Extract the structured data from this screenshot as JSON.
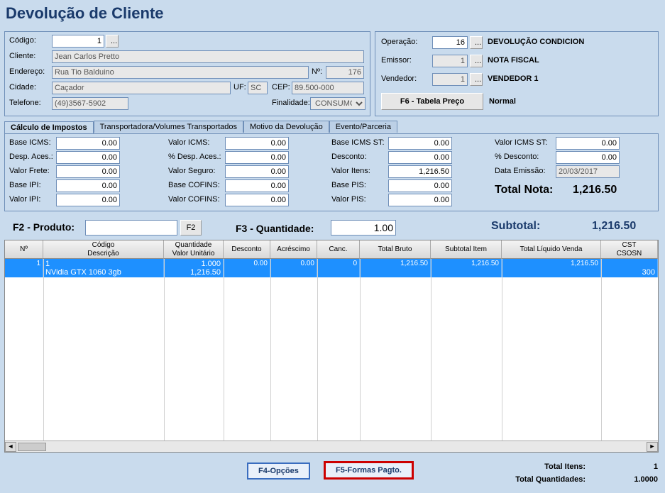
{
  "title": "Devolução de Cliente",
  "left_box": {
    "codigo_label": "Código:",
    "codigo_value": "1",
    "codigo_ellipsis": "...",
    "cliente_label": "Cliente:",
    "cliente_value": "Jean Carlos Pretto",
    "endereco_label": "Endereço:",
    "endereco_value": "Rua Tio Balduino",
    "num_label": "Nº:",
    "num_value": "176",
    "cidade_label": "Cidade:",
    "cidade_value": "Caçador",
    "uf_label": "UF:",
    "uf_value": "SC",
    "cep_label": "CEP:",
    "cep_value": "89.500-000",
    "telefone_label": "Telefone:",
    "telefone_value": "(49)3567-5902",
    "finalidade_label": "Finalidade:",
    "finalidade_value": "CONSUMO"
  },
  "right_box": {
    "operacao_label": "Operação:",
    "operacao_value": "16",
    "operacao_desc": "DEVOLUÇÃO CONDICION",
    "emissor_label": "Emissor:",
    "emissor_value": "1",
    "emissor_desc": "NOTA FISCAL",
    "vendedor_label": "Vendedor:",
    "vendedor_value": "1",
    "vendedor_desc": "VENDEDOR 1",
    "f6_button": "F6 - Tabela Preço",
    "f6_desc": "Normal",
    "ellipsis": "..."
  },
  "tabs": {
    "t1": "Cálculo de Impostos",
    "t2": "Transportadora/Volumes Transportados",
    "t3": "Motivo da Devolução",
    "t4": "Evento/Parceria"
  },
  "tax": {
    "base_icms_l": "Base ICMS:",
    "base_icms_v": "0.00",
    "desp_aces_l": "Desp. Aces.:",
    "desp_aces_v": "0.00",
    "valor_frete_l": "Valor Frete:",
    "valor_frete_v": "0.00",
    "base_ipi_l": "Base IPI:",
    "base_ipi_v": "0.00",
    "valor_ipi_l": "Valor IPI:",
    "valor_ipi_v": "0.00",
    "valor_icms_l": "Valor ICMS:",
    "valor_icms_v": "0.00",
    "pct_desp_l": "% Desp. Aces.:",
    "pct_desp_v": "0.00",
    "valor_seguro_l": "Valor Seguro:",
    "valor_seguro_v": "0.00",
    "base_cofins_l": "Base COFINS:",
    "base_cofins_v": "0.00",
    "valor_cofins_l": "Valor COFINS:",
    "valor_cofins_v": "0.00",
    "base_icms_st_l": "Base ICMS ST:",
    "base_icms_st_v": "0.00",
    "desconto_l": "Desconto:",
    "desconto_v": "0.00",
    "valor_itens_l": "Valor Itens:",
    "valor_itens_v": "1,216.50",
    "base_pis_l": "Base PIS:",
    "base_pis_v": "0.00",
    "valor_pis_l": "Valor PIS:",
    "valor_pis_v": "0.00",
    "valor_icms_st2_l": "Valor ICMS ST:",
    "valor_icms_st2_v": "0.00",
    "pct_desconto_l": "% Desconto:",
    "pct_desconto_v": "0.00",
    "data_emissao_l": "Data Emissão:",
    "data_emissao_v": "20/03/2017",
    "total_nota_l": "Total Nota:",
    "total_nota_v": "1,216.50"
  },
  "middle": {
    "f2_label": "F2 - Produto:",
    "f2_button": "F2",
    "f3_label": "F3 - Quantidade:",
    "f3_value": "1.00",
    "subtotal_label": "Subtotal:",
    "subtotal_value": "1,216.50"
  },
  "table": {
    "headers": {
      "num": "Nº",
      "codigo": "Código\nDescrição",
      "qtd": "Quantidade\nValor Unitário",
      "desc": "Desconto",
      "acr": "Acréscimo",
      "canc": "Canc.",
      "bruto": "Total Bruto",
      "subitem": "Subtotal Item",
      "liquido": "Total Líquido Venda",
      "cst": "CST\nCSOSN"
    },
    "row": {
      "num": "1",
      "codigo": "1",
      "descricao": "NVidia GTX 1060 3gb",
      "qtd": "1.000",
      "valor_unit": "1,216.50",
      "desc": "0.00",
      "acr": "0.00",
      "canc": "0",
      "bruto": "1,216.50",
      "subitem": "1,216.50",
      "liquido": "1,216.50",
      "cst": "300"
    }
  },
  "footer": {
    "f4": "F4-Opções",
    "f5": "F5-Formas Pagto.",
    "total_itens_l": "Total Itens:",
    "total_itens_v": "1",
    "total_qtd_l": "Total Quantidades:",
    "total_qtd_v": "1.0000"
  }
}
